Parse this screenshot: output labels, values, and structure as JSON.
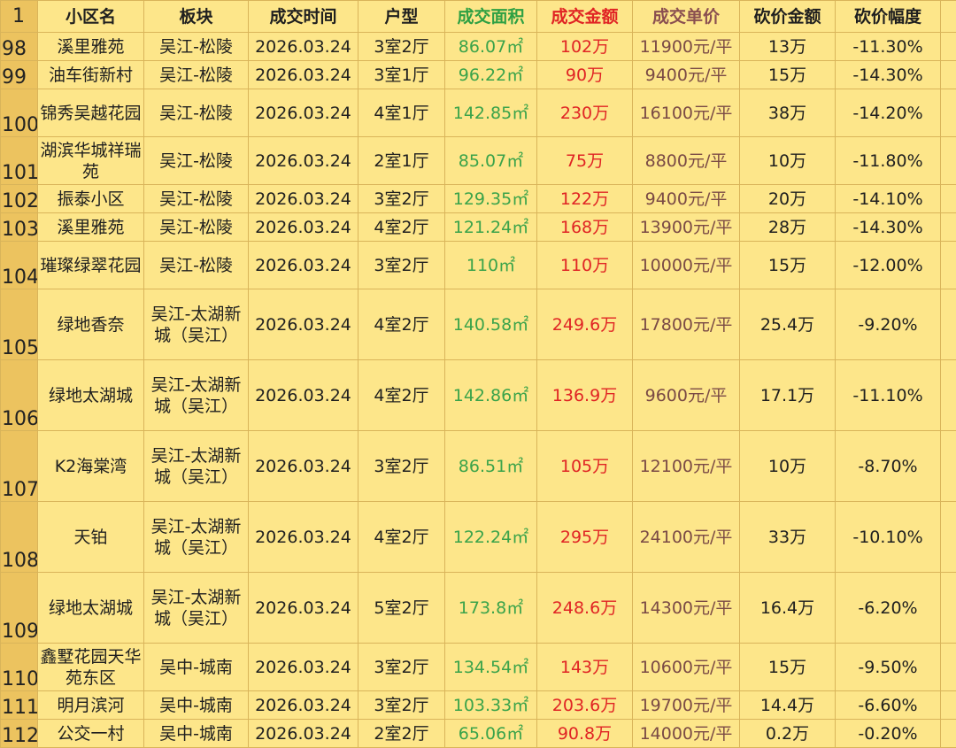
{
  "colors": {
    "background": "#fde68a",
    "row_header": "#ecc35f",
    "grid": "#d9b45a",
    "area_text": "#3aa34a",
    "amount_text": "#e02424",
    "unit_price_text": "#7a4a45"
  },
  "header_row": {
    "row_number": "1",
    "columns": [
      "小区名",
      "板块",
      "成交时间",
      "户型",
      "成交面积",
      "成交金额",
      "成交单价",
      "砍价金额",
      "砍价幅度"
    ]
  },
  "rows": [
    {
      "num": "98",
      "name": "溪里雅苑",
      "block": "吴江-松陵",
      "date": "2026.03.24",
      "layout": "3室2厅",
      "area": "86.07㎡",
      "amount": "102万",
      "unit_price": "11900元/平",
      "cut": "13万",
      "cut_pct": "-11.30%"
    },
    {
      "num": "99",
      "name": "油车街新村",
      "block": "吴江-松陵",
      "date": "2026.03.24",
      "layout": "3室1厅",
      "area": "96.22㎡",
      "amount": "90万",
      "unit_price": "9400元/平",
      "cut": "15万",
      "cut_pct": "-14.30%"
    },
    {
      "num": "100",
      "name": "锦秀吴越花园",
      "block": "吴江-松陵",
      "date": "2026.03.24",
      "layout": "4室1厅",
      "area": "142.85㎡",
      "amount": "230万",
      "unit_price": "16100元/平",
      "cut": "38万",
      "cut_pct": "-14.20%"
    },
    {
      "num": "101",
      "name": "湖滨华城祥瑞苑",
      "block": "吴江-松陵",
      "date": "2026.03.24",
      "layout": "2室1厅",
      "area": "85.07㎡",
      "amount": "75万",
      "unit_price": "8800元/平",
      "cut": "10万",
      "cut_pct": "-11.80%"
    },
    {
      "num": "102",
      "name": "振泰小区",
      "block": "吴江-松陵",
      "date": "2026.03.24",
      "layout": "3室2厅",
      "area": "129.35㎡",
      "amount": "122万",
      "unit_price": "9400元/平",
      "cut": "20万",
      "cut_pct": "-14.10%"
    },
    {
      "num": "103",
      "name": "溪里雅苑",
      "block": "吴江-松陵",
      "date": "2026.03.24",
      "layout": "4室2厅",
      "area": "121.24㎡",
      "amount": "168万",
      "unit_price": "13900元/平",
      "cut": "28万",
      "cut_pct": "-14.30%"
    },
    {
      "num": "104",
      "name": "璀璨绿翠花园",
      "block": "吴江-松陵",
      "date": "2026.03.24",
      "layout": "3室2厅",
      "area": "110㎡",
      "amount": "110万",
      "unit_price": "10000元/平",
      "cut": "15万",
      "cut_pct": "-12.00%"
    },
    {
      "num": "105",
      "name": "绿地香奈",
      "block": "吴江-太湖新城（吴江）",
      "date": "2026.03.24",
      "layout": "4室2厅",
      "area": "140.58㎡",
      "amount": "249.6万",
      "unit_price": "17800元/平",
      "cut": "25.4万",
      "cut_pct": "-9.20%"
    },
    {
      "num": "106",
      "name": "绿地太湖城",
      "block": "吴江-太湖新城（吴江）",
      "date": "2026.03.24",
      "layout": "4室2厅",
      "area": "142.86㎡",
      "amount": "136.9万",
      "unit_price": "9600元/平",
      "cut": "17.1万",
      "cut_pct": "-11.10%"
    },
    {
      "num": "107",
      "name": "K2海棠湾",
      "block": "吴江-太湖新城（吴江）",
      "date": "2026.03.24",
      "layout": "3室2厅",
      "area": "86.51㎡",
      "amount": "105万",
      "unit_price": "12100元/平",
      "cut": "10万",
      "cut_pct": "-8.70%"
    },
    {
      "num": "108",
      "name": "天铂",
      "block": "吴江-太湖新城（吴江）",
      "date": "2026.03.24",
      "layout": "4室2厅",
      "area": "122.24㎡",
      "amount": "295万",
      "unit_price": "24100元/平",
      "cut": "33万",
      "cut_pct": "-10.10%"
    },
    {
      "num": "109",
      "name": "绿地太湖城",
      "block": "吴江-太湖新城（吴江）",
      "date": "2026.03.24",
      "layout": "5室2厅",
      "area": "173.8㎡",
      "amount": "248.6万",
      "unit_price": "14300元/平",
      "cut": "16.4万",
      "cut_pct": "-6.20%"
    },
    {
      "num": "110",
      "name": "鑫墅花园天华苑东区",
      "block": "吴中-城南",
      "date": "2026.03.24",
      "layout": "3室2厅",
      "area": "134.54㎡",
      "amount": "143万",
      "unit_price": "10600元/平",
      "cut": "15万",
      "cut_pct": "-9.50%"
    },
    {
      "num": "111",
      "name": "明月滨河",
      "block": "吴中-城南",
      "date": "2026.03.24",
      "layout": "3室2厅",
      "area": "103.33㎡",
      "amount": "203.6万",
      "unit_price": "19700元/平",
      "cut": "14.4万",
      "cut_pct": "-6.60%"
    },
    {
      "num": "112",
      "name": "公交一村",
      "block": "吴中-城南",
      "date": "2026.03.24",
      "layout": "2室2厅",
      "area": "65.06㎡",
      "amount": "90.8万",
      "unit_price": "14000元/平",
      "cut": "0.2万",
      "cut_pct": "-0.20%"
    }
  ]
}
